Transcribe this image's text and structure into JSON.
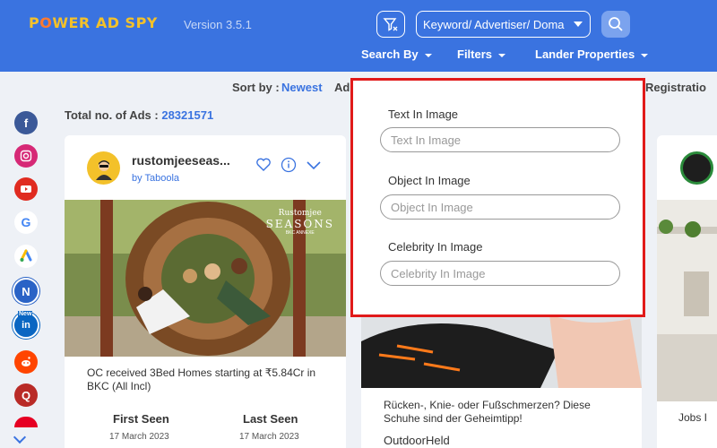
{
  "header": {
    "logo": {
      "part1": "P",
      "part2": "O",
      "part3": "WER AD SPY"
    },
    "version": "Version 3.5.1",
    "search_select": "Keyword/ Advertiser/ Doma",
    "nav": {
      "search_by": "Search By",
      "filters": "Filters",
      "lander": "Lander Properties"
    }
  },
  "sort": {
    "label": "Sort by :",
    "value": "Newest",
    "ad_partial": "Ad",
    "reg_partial": "Registratio"
  },
  "total": {
    "label": "Total no. of Ads :",
    "value": "28321571"
  },
  "sidebar_icons": [
    "facebook-icon",
    "instagram-icon",
    "youtube-icon",
    "google-icon",
    "google-ads-icon",
    "native-icon",
    "linkedin-icon",
    "reddit-icon",
    "quora-icon",
    "pinterest-icon"
  ],
  "sidebar_labels": {
    "google": "G",
    "native": "N",
    "linkedin": "in",
    "linkedin_badge": "New",
    "quora": "Q"
  },
  "card1": {
    "advertiser": "rustomjeeseas...",
    "via": "by Taboola",
    "image_brand": "Rustomjee",
    "image_title": "SEASONS",
    "image_sub": "BKC ANNEXE",
    "text": "OC received 3Bed Homes starting at ₹5.84Cr in BKC (All Incl)",
    "first_seen_label": "First Seen",
    "first_seen": "17 March 2023",
    "last_seen_label": "Last Seen",
    "last_seen": "17 March 2023"
  },
  "card2": {
    "text": "Rücken-, Knie- oder Fußschmerzen? Diese Schuhe sind der Geheimtipp!",
    "advertiser": "OutdoorHeld"
  },
  "card3": {
    "text_partial": "Jobs I"
  },
  "popup": {
    "text_label": "Text In Image",
    "text_placeholder": "Text In Image",
    "object_label": "Object In Image",
    "object_placeholder": "Object In Image",
    "celebrity_label": "Celebrity In Image",
    "celebrity_placeholder": "Celebrity In Image"
  },
  "colors": {
    "primary": "#3a73e0",
    "popup_border": "#e11a1a",
    "logo_yellow": "#f3c12a"
  }
}
